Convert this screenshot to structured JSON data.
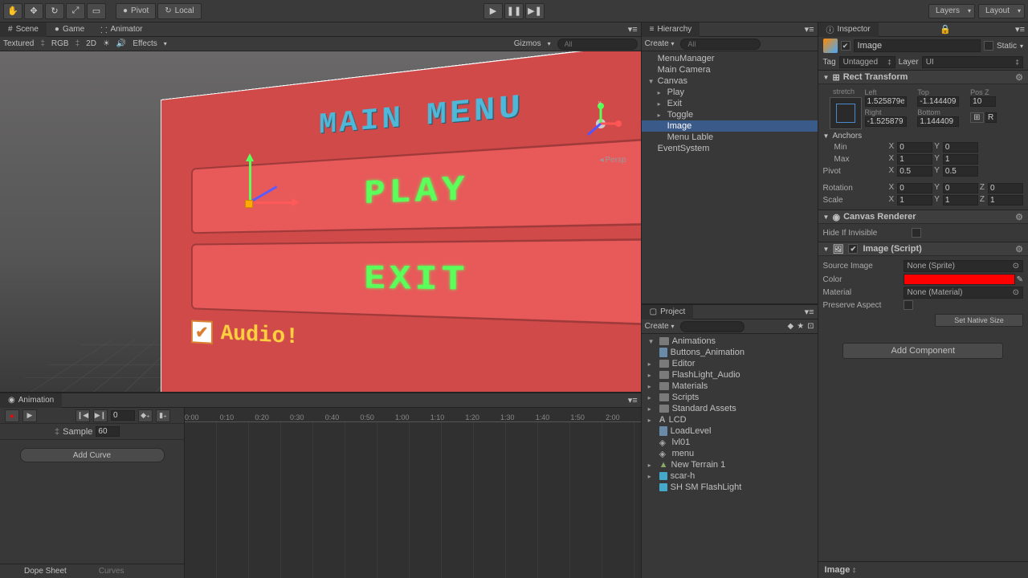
{
  "toolbar": {
    "pivot": "Pivot",
    "local": "Local",
    "layers": "Layers",
    "layout": "Layout"
  },
  "scene": {
    "tab_scene": "Scene",
    "tab_game": "Game",
    "tab_animator": "Animator",
    "sub_textured": "Textured",
    "sub_rgb": "RGB",
    "sub_2d": "2D",
    "sub_effects": "Effects",
    "sub_gizmos": "Gizmos",
    "sub_all": "All",
    "persp": "Persp",
    "menu_title": "MAIN MENU",
    "play_btn": "PLAY",
    "exit_btn": "EXIT",
    "audio_label": "Audio!"
  },
  "animation": {
    "tab": "Animation",
    "frame": "0",
    "sample_label": "Sample",
    "sample": "60",
    "add_curve": "Add Curve",
    "dope_sheet": "Dope Sheet",
    "curves": "Curves",
    "ticks": [
      "0:00",
      "0:10",
      "0:20",
      "0:30",
      "0:40",
      "0:50",
      "1:00",
      "1:10",
      "1:20",
      "1:30",
      "1:40",
      "1:50",
      "2:00"
    ]
  },
  "hierarchy": {
    "tab": "Hierarchy",
    "create": "Create",
    "search_all": "All",
    "items": [
      {
        "label": "MenuManager",
        "depth": 0
      },
      {
        "label": "Main Camera",
        "depth": 0
      },
      {
        "label": "Canvas",
        "depth": 0,
        "arrow": "▼"
      },
      {
        "label": "Play",
        "depth": 1,
        "arrow": "▸"
      },
      {
        "label": "Exit",
        "depth": 1,
        "arrow": "▸"
      },
      {
        "label": "Toggle",
        "depth": 1,
        "arrow": "▸"
      },
      {
        "label": "Image",
        "depth": 1,
        "selected": true
      },
      {
        "label": "Menu Lable",
        "depth": 1
      },
      {
        "label": "EventSystem",
        "depth": 0
      }
    ]
  },
  "project": {
    "tab": "Project",
    "create": "Create",
    "items": [
      {
        "label": "Animations",
        "type": "folder",
        "arrow": "▼"
      },
      {
        "label": "Buttons_Animation",
        "type": "file",
        "indent": 1
      },
      {
        "label": "Editor",
        "type": "folder",
        "arrow": "▸"
      },
      {
        "label": "FlashLight_Audio",
        "type": "folder",
        "arrow": "▸"
      },
      {
        "label": "Materials",
        "type": "folder",
        "arrow": "▸"
      },
      {
        "label": "Scripts",
        "type": "folder",
        "arrow": "▸"
      },
      {
        "label": "Standard Assets",
        "type": "folder",
        "arrow": "▸"
      },
      {
        "label": "LCD",
        "type": "font",
        "arrow": "▸"
      },
      {
        "label": "LoadLevel",
        "type": "script"
      },
      {
        "label": "lvl01",
        "type": "scene"
      },
      {
        "label": "menu",
        "type": "scene"
      },
      {
        "label": "New Terrain 1",
        "type": "terrain",
        "arrow": "▸"
      },
      {
        "label": "scar-h",
        "type": "prefab",
        "arrow": "▸"
      },
      {
        "label": "SH SM FlashLight",
        "type": "prefab"
      }
    ]
  },
  "inspector": {
    "tab": "Inspector",
    "name": "Image",
    "static": "Static",
    "tag_label": "Tag",
    "tag": "Untagged",
    "layer_label": "Layer",
    "layer": "UI",
    "rect_transform": {
      "title": "Rect Transform",
      "stretch_top": "stretch",
      "stretch_left": "stretch",
      "left_label": "Left",
      "left": "1.525879e",
      "top_label": "Top",
      "top": "-1.144409",
      "posz_label": "Pos Z",
      "posz": "10",
      "right_label": "Right",
      "right": "-1.525879",
      "bottom_label": "Bottom",
      "bottom": "1.144409",
      "r_btn": "R",
      "anchors": "Anchors",
      "min": "Min",
      "min_x": "0",
      "min_y": "0",
      "max": "Max",
      "max_x": "1",
      "max_y": "1",
      "pivot": "Pivot",
      "pivot_x": "0.5",
      "pivot_y": "0.5",
      "rotation": "Rotation",
      "rot_x": "0",
      "rot_y": "0",
      "rot_z": "0",
      "scale": "Scale",
      "scale_x": "1",
      "scale_y": "1",
      "scale_z": "1"
    },
    "canvas_renderer": {
      "title": "Canvas Renderer",
      "hide_label": "Hide If Invisible"
    },
    "image_script": {
      "title": "Image (Script)",
      "source_label": "Source Image",
      "source_val": "None (Sprite)",
      "color_label": "Color",
      "material_label": "Material",
      "material_val": "None (Material)",
      "preserve_label": "Preserve Aspect",
      "set_native": "Set Native Size"
    },
    "add_component": "Add Component",
    "footer": "Image"
  }
}
